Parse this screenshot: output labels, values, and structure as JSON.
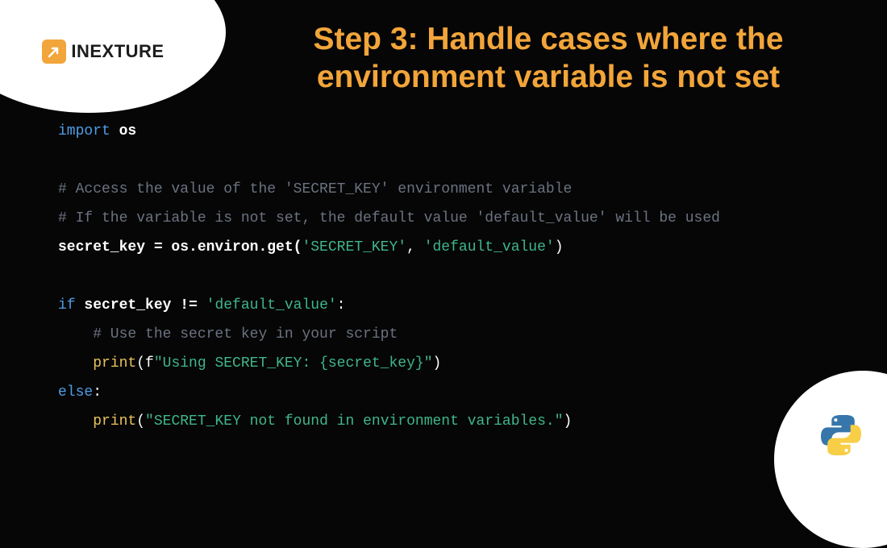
{
  "logo": {
    "text": "INEXTURE"
  },
  "heading": {
    "line1": "Step 3: Handle cases where the",
    "line2": "environment variable is not set"
  },
  "code": {
    "l1_kw": "import",
    "l1_mod": "os",
    "l2_cmt": "# Access the value of the 'SECRET_KEY' environment variable",
    "l3_cmt": "# If the variable is not set, the default value 'default_value' will be used",
    "l4_lhs": "secret_key = os.environ.get(",
    "l4_s1": "'SECRET_KEY'",
    "l4_mid": ", ",
    "l4_s2": "'default_value'",
    "l4_end": ")",
    "l5_if": "if",
    "l5_expr": " secret_key != ",
    "l5_s": "'default_value'",
    "l5_colon": ":",
    "l6_cmt": "    # Use the secret key in your script",
    "l7_indent": "    ",
    "l7_fn": "print",
    "l7_open": "(f",
    "l7_s": "\"Using SECRET_KEY: {secret_key}\"",
    "l7_close": ")",
    "l8_else": "else",
    "l8_colon": ":",
    "l9_indent": "    ",
    "l9_fn": "print",
    "l9_open": "(",
    "l9_s": "\"SECRET_KEY not found in environment variables.\"",
    "l9_close": ")"
  },
  "icons": {
    "logo": "arrow-icon",
    "corner": "python-icon"
  }
}
